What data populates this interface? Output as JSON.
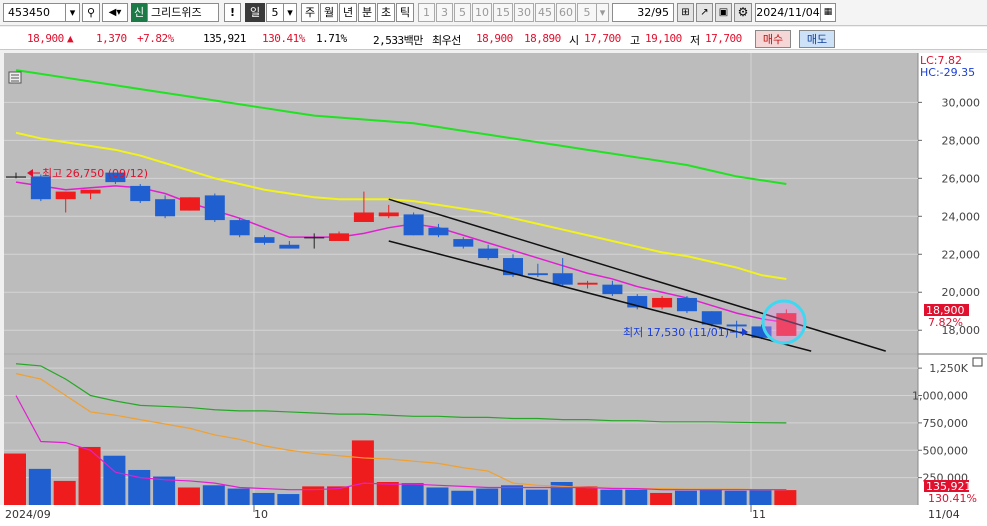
{
  "toolbar": {
    "code": "453450",
    "shin_badge": "신",
    "stock_name": "그리드위즈",
    "alert_symbol": "!",
    "period_day": "일",
    "period_value": "5",
    "periods": [
      "주",
      "월",
      "년",
      "분",
      "초",
      "틱"
    ],
    "minute_options": [
      "1",
      "3",
      "5",
      "10",
      "15",
      "30",
      "45",
      "60"
    ],
    "minute_value": "5",
    "page_counter": "32/95",
    "date": "2024/11/04"
  },
  "quote": {
    "price": "18,900",
    "change_arrow": "▲",
    "change": "1,370",
    "change_pct": "+7.82%",
    "volume": "135,921",
    "volume_ratio": "130.41%",
    "turnover": "1.71%",
    "amount": "2,533백만",
    "best_bid_label": "최우선",
    "best_ask": "18,900",
    "best_bid": "18,890",
    "open_label": "시",
    "open": "17,700",
    "high_label": "고",
    "high": "19,100",
    "low_label": "저",
    "low": "17,700",
    "buy_label": "매수",
    "sell_label": "매도"
  },
  "chart": {
    "lc_label": "LC:7.82",
    "hc_label": "HC:-29.35",
    "price_badge": "18,900",
    "pct_badge": "7.82%",
    "volume_badge": "135,921",
    "volume_pct_badge": "130.41%",
    "max_annotation": "최고 26,750 (09/12)",
    "min_annotation": "최저 17,530 (11/01)",
    "date_labels": [
      "2024/09",
      "10",
      "11",
      "11/04"
    ],
    "price_axis": [
      "30,000",
      "28,000",
      "26,000",
      "24,000",
      "22,000",
      "20,000",
      "18,000"
    ],
    "volume_axis": [
      "1,250K",
      "1,000,000",
      "750,000",
      "500,000",
      "250,000"
    ],
    "colors": {
      "up": "#ee1c1c",
      "down": "#1f5fd0",
      "ma5": "#e020d0",
      "ma20": "#f2f21c",
      "ma60": "#22e022",
      "bg": "#bcbcbc"
    }
  },
  "chart_data": {
    "type": "candlestick",
    "candles": [
      {
        "o": 26100,
        "h": 26300,
        "c": 26100,
        "l": 26000
      },
      {
        "o": 26100,
        "h": 26200,
        "c": 24900,
        "l": 24800
      },
      {
        "o": 24900,
        "h": 25300,
        "c": 25300,
        "l": 24200
      },
      {
        "o": 25200,
        "h": 25400,
        "c": 25400,
        "l": 24900
      },
      {
        "o": 26300,
        "h": 26300,
        "c": 25800,
        "l": 25700
      },
      {
        "o": 25600,
        "h": 25700,
        "c": 24800,
        "l": 24700
      },
      {
        "o": 24900,
        "h": 25100,
        "c": 24000,
        "l": 23900
      },
      {
        "o": 24300,
        "h": 25000,
        "c": 25000,
        "l": 24300
      },
      {
        "o": 25100,
        "h": 25200,
        "c": 23800,
        "l": 23700
      },
      {
        "o": 23800,
        "h": 23900,
        "c": 23000,
        "l": 22900
      },
      {
        "o": 22900,
        "h": 23000,
        "c": 22600,
        "l": 22500
      },
      {
        "o": 22500,
        "h": 22700,
        "c": 22300,
        "l": 22300
      },
      {
        "o": 22900,
        "h": 23100,
        "c": 22900,
        "l": 22300
      },
      {
        "o": 22700,
        "h": 23200,
        "c": 23100,
        "l": 22700
      },
      {
        "o": 23700,
        "h": 25300,
        "c": 24200,
        "l": 23700
      },
      {
        "o": 24000,
        "h": 24600,
        "c": 24200,
        "l": 23900
      },
      {
        "o": 24100,
        "h": 24200,
        "c": 23000,
        "l": 23000
      },
      {
        "o": 23400,
        "h": 23600,
        "c": 23000,
        "l": 22900
      },
      {
        "o": 22800,
        "h": 22900,
        "c": 22400,
        "l": 22300
      },
      {
        "o": 22300,
        "h": 22500,
        "c": 21800,
        "l": 21700
      },
      {
        "o": 21800,
        "h": 22000,
        "c": 20900,
        "l": 20800
      },
      {
        "o": 21000,
        "h": 21500,
        "c": 20900,
        "l": 20800
      },
      {
        "o": 21000,
        "h": 21800,
        "c": 20400,
        "l": 20300
      },
      {
        "o": 20400,
        "h": 20600,
        "c": 20500,
        "l": 20200
      },
      {
        "o": 20400,
        "h": 20600,
        "c": 19900,
        "l": 19800
      },
      {
        "o": 19800,
        "h": 19900,
        "c": 19200,
        "l": 19100
      },
      {
        "o": 19200,
        "h": 19800,
        "c": 19700,
        "l": 19100
      },
      {
        "o": 19700,
        "h": 19800,
        "c": 19000,
        "l": 18900
      },
      {
        "o": 19000,
        "h": 19000,
        "c": 18300,
        "l": 18200
      },
      {
        "o": 18300,
        "h": 18500,
        "c": 18200,
        "l": 17600
      },
      {
        "o": 18200,
        "h": 18300,
        "c": 17600,
        "l": 17530
      },
      {
        "o": 17700,
        "h": 19100,
        "c": 18900,
        "l": 17700
      }
    ],
    "ma5": [
      25800,
      25600,
      25400,
      25500,
      25600,
      25500,
      25200,
      24700,
      24300,
      23900,
      23400,
      22900,
      22900,
      22900,
      23100,
      23400,
      23600,
      23400,
      23000,
      22600,
      22200,
      21800,
      21400,
      21000,
      20700,
      20300,
      20000,
      19700,
      19300,
      18900,
      18600,
      18400
    ],
    "ma20": [
      28400,
      28100,
      27900,
      27700,
      27500,
      27200,
      26800,
      26400,
      26000,
      25700,
      25400,
      25200,
      25000,
      24900,
      24900,
      24900,
      24800,
      24600,
      24400,
      24200,
      23900,
      23600,
      23300,
      23000,
      22700,
      22400,
      22100,
      21900,
      21600,
      21300,
      20900,
      20700
    ],
    "ma60": [
      31700,
      31500,
      31300,
      31100,
      30900,
      30700,
      30500,
      30300,
      30100,
      29900,
      29700,
      29500,
      29300,
      29200,
      29100,
      29000,
      28900,
      28700,
      28500,
      28300,
      28100,
      27900,
      27700,
      27500,
      27300,
      27100,
      26900,
      26700,
      26400,
      26100,
      25900,
      25700
    ],
    "volume": [
      470000,
      330000,
      220000,
      530000,
      450000,
      320000,
      260000,
      160000,
      180000,
      150000,
      110000,
      100000,
      170000,
      170000,
      590000,
      210000,
      200000,
      160000,
      130000,
      150000,
      180000,
      140000,
      210000,
      170000,
      140000,
      140000,
      110000,
      130000,
      140000,
      130000,
      135000,
      135921
    ],
    "vol_ma5": [
      1290000,
      1270000,
      1150000,
      1000000,
      950000,
      910000,
      900000,
      890000,
      870000,
      860000,
      860000,
      850000,
      840000,
      830000,
      830000,
      820000,
      810000,
      810000,
      800000,
      800000,
      790000,
      790000,
      780000,
      780000,
      770000,
      770000,
      760000,
      760000,
      760000,
      755000,
      752000,
      750000
    ],
    "vol_ma20": [
      1200000,
      1150000,
      1000000,
      850000,
      820000,
      780000,
      740000,
      700000,
      640000,
      600000,
      540000,
      500000,
      470000,
      450000,
      430000,
      420000,
      400000,
      380000,
      340000,
      310000,
      200000,
      180000,
      170000,
      160000,
      160000,
      150000,
      150000,
      145000,
      145000,
      145000,
      140000,
      140000
    ],
    "vol_ma60": [
      1000000,
      580000,
      570000,
      500000,
      300000,
      250000,
      230000,
      220000,
      200000,
      160000,
      150000,
      140000,
      140000,
      150000,
      200000,
      190000,
      190000,
      180000,
      170000,
      160000,
      160000,
      160000,
      160000,
      160000,
      150000,
      150000,
      140000,
      140000,
      140000,
      140000,
      140000,
      140000
    ],
    "price_ylim": [
      16800,
      32600
    ],
    "volume_ylim": [
      0,
      1370000
    ],
    "trend_upper": {
      "from": 15,
      "from_val": 24900,
      "to": 35,
      "to_val": 16900
    },
    "trend_lower": {
      "from": 15,
      "from_val": 22700,
      "to": 32,
      "to_val": 16900
    }
  }
}
